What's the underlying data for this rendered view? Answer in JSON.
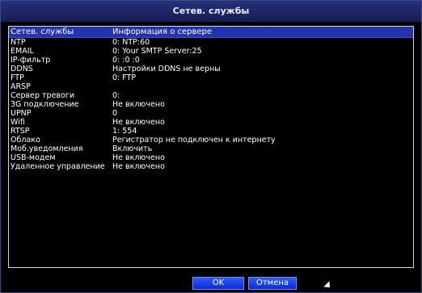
{
  "window": {
    "title": "Сетев. службы"
  },
  "table": {
    "headers": {
      "service": "Сетев. службы",
      "info": "Информация о сервере"
    },
    "rows": [
      {
        "service": "NTP",
        "info": "0: NTP:60"
      },
      {
        "service": "EMAIL",
        "info": "0: Your SMTP Server:25"
      },
      {
        "service": "IP-фильтр",
        "info": "0: :0 :0"
      },
      {
        "service": "DDNS",
        "info": "Настройки DDNS не верны"
      },
      {
        "service": "FTP",
        "info": "0: FTP"
      },
      {
        "service": "ARSP",
        "info": ""
      },
      {
        "service": "Сервер тревоги",
        "info": "0:"
      },
      {
        "service": "3G подключение",
        "info": "Не включено"
      },
      {
        "service": "UPNP",
        "info": "0"
      },
      {
        "service": "Wifi",
        "info": "Не включено"
      },
      {
        "service": "RTSP",
        "info": "1: 554"
      },
      {
        "service": "Облако",
        "info": "Регистратор не подключен к интернету"
      },
      {
        "service": "Моб.уведомления",
        "info": "Включить"
      },
      {
        "service": "USB-модем",
        "info": "Не включено"
      },
      {
        "service": "Удаленное управление",
        "info": "Не включено"
      }
    ]
  },
  "buttons": {
    "ok": "OK",
    "cancel": "Отмена"
  }
}
